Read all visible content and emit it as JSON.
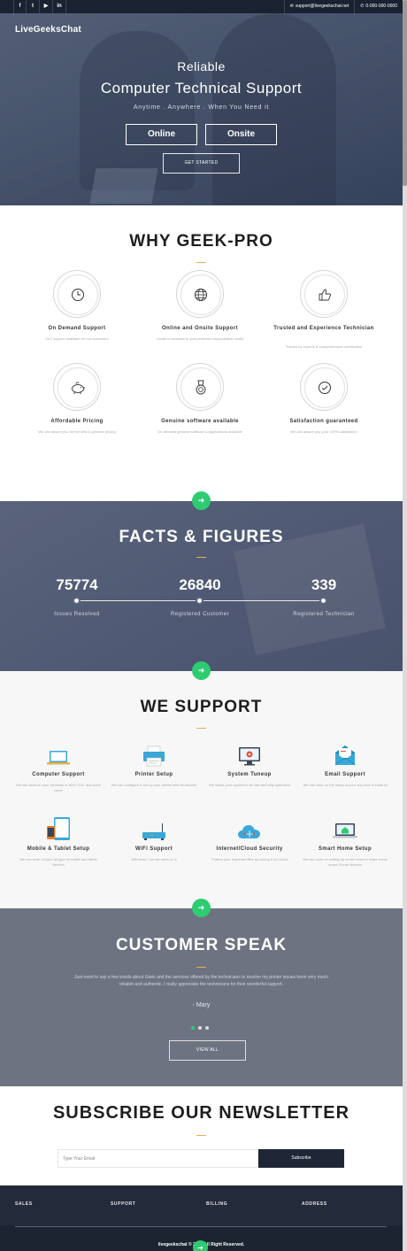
{
  "topbar": {
    "social": [
      "f",
      "t",
      "▶",
      "in"
    ],
    "email": "support@livegeekschat.net",
    "phone": "0-000-000-0000"
  },
  "hero": {
    "logo": "LiveGeeksChat",
    "line1": "Reliable",
    "title": "Computer Technical Support",
    "tagline": "Anytime . Anywhere . When You Need it",
    "btn_online": "Online",
    "btn_onsite": "Onsite",
    "btn_started": "GET STARTED"
  },
  "why": {
    "title": "WHY GEEK-PRO",
    "features": [
      {
        "icon": "clock-icon",
        "title": "On Demand Support",
        "desc": "24/7 support available for our customers"
      },
      {
        "icon": "globe-icon",
        "title": "Online and Onsite Support",
        "desc": "Onsite is available in your preferred city/available onsite"
      },
      {
        "icon": "thumbs-up-icon",
        "title": "Trusted and Experience Technician",
        "desc": "Trained by experts & comprehensive certification"
      },
      {
        "icon": "piggy-bank-icon",
        "title": "Affordable Pricing",
        "desc": "We can assure you for the best & genuine pricing"
      },
      {
        "icon": "medal-icon",
        "title": "Genuine software available",
        "desc": "On demand genuine software & applications available"
      },
      {
        "icon": "check-circle-icon",
        "title": "Satisfaction guaranteed",
        "desc": "We can assure you your 100% satisfaction"
      }
    ]
  },
  "facts": {
    "title": "FACTS & FIGURES",
    "items": [
      {
        "num": "75774",
        "label": "Issues Resolved"
      },
      {
        "num": "26840",
        "label": "Registered Customer"
      },
      {
        "num": "339",
        "label": "Registered Technician"
      }
    ]
  },
  "support": {
    "title": "WE SUPPORT",
    "items": [
      {
        "icon": "laptop-icon",
        "title": "Computer Support",
        "desc": "We can work on your windows or MAC O.S. and solve issue"
      },
      {
        "icon": "printer-icon",
        "title": "Printer Setup",
        "desc": "We can configure & set up your printer with all devices"
      },
      {
        "icon": "monitor-gear-icon",
        "title": "System Tuneup",
        "desc": "We tweak your system to be fast and fully optimized"
      },
      {
        "icon": "email-icon",
        "title": "Email Support",
        "desc": "We can work on the setup of your any kind of email id"
      },
      {
        "icon": "tablet-icon",
        "title": "Mobile & Tablet Setup",
        "desc": "We can work on your all type of mobile and tablet devices"
      },
      {
        "icon": "router-icon",
        "title": "WiFi Support",
        "desc": "Wifi issue / we can work on it"
      },
      {
        "icon": "cloud-icon",
        "title": "Internet/Cloud Security",
        "desc": "Protect your important files by saving it on Cloud"
      },
      {
        "icon": "smart-home-icon",
        "title": "Smart Home Setup",
        "desc": "We can work on setting up smart home to make home smart. Home devices"
      }
    ]
  },
  "speak": {
    "title": "CUSTOMER SPEAK",
    "quote": "Just need to say a few words about Geek and the services offered by the technicians to resolve my printer issues been very much reliable and authentic. I really appreciate the technicians for their wonderful support.",
    "author": "- Mary",
    "view_all": "VIEW ALL"
  },
  "news": {
    "title": "SUBSCRIBE OUR NEWSLETTER",
    "placeholder": "Type Your Email",
    "button": "Subscribe"
  },
  "footer": {
    "cols": [
      "SALES",
      "SUPPORT",
      "BILLING",
      "ADDRESS"
    ],
    "copyright": "livegeekschat © 2019 All Right Reserved."
  },
  "colors": {
    "accent": "#2ecc71",
    "gold": "#e5b04c",
    "dark": "#1f2736"
  }
}
